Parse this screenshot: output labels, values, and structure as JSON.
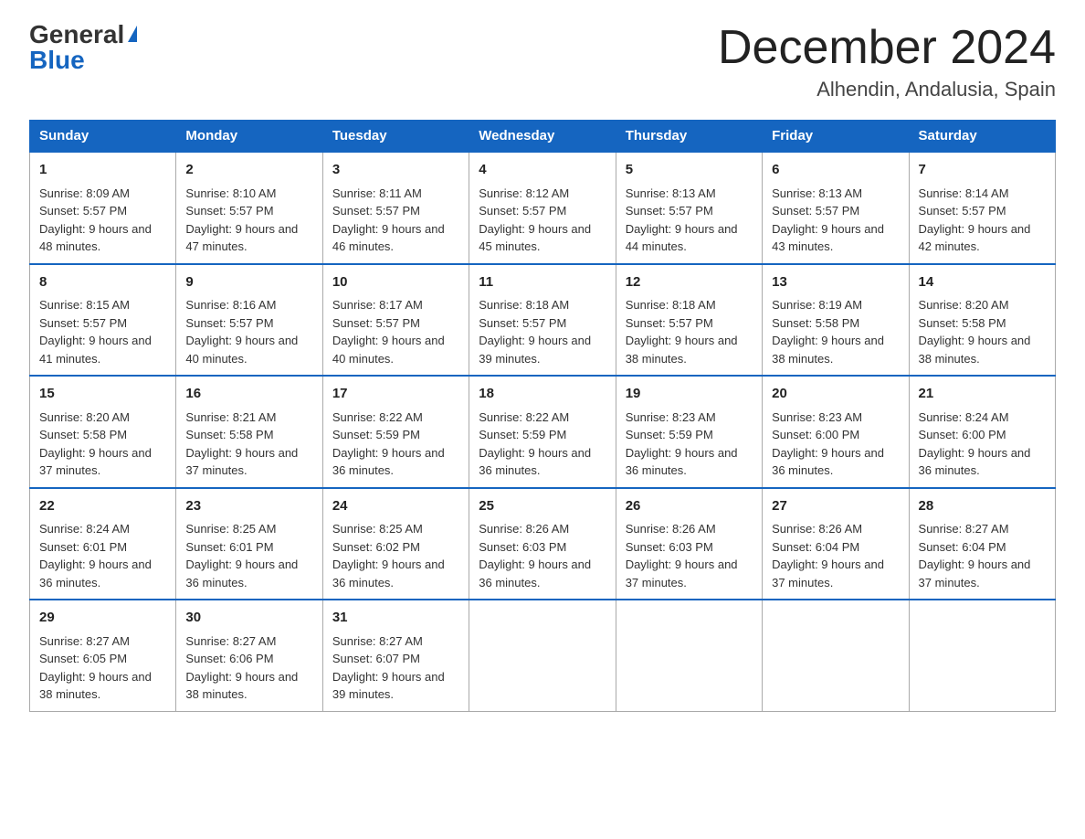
{
  "logo": {
    "general": "General",
    "triangle": "▶",
    "blue": "Blue"
  },
  "title": "December 2024",
  "location": "Alhendin, Andalusia, Spain",
  "days_header": [
    "Sunday",
    "Monday",
    "Tuesday",
    "Wednesday",
    "Thursday",
    "Friday",
    "Saturday"
  ],
  "weeks": [
    [
      {
        "day": "1",
        "sunrise": "8:09 AM",
        "sunset": "5:57 PM",
        "daylight": "9 hours and 48 minutes."
      },
      {
        "day": "2",
        "sunrise": "8:10 AM",
        "sunset": "5:57 PM",
        "daylight": "9 hours and 47 minutes."
      },
      {
        "day": "3",
        "sunrise": "8:11 AM",
        "sunset": "5:57 PM",
        "daylight": "9 hours and 46 minutes."
      },
      {
        "day": "4",
        "sunrise": "8:12 AM",
        "sunset": "5:57 PM",
        "daylight": "9 hours and 45 minutes."
      },
      {
        "day": "5",
        "sunrise": "8:13 AM",
        "sunset": "5:57 PM",
        "daylight": "9 hours and 44 minutes."
      },
      {
        "day": "6",
        "sunrise": "8:13 AM",
        "sunset": "5:57 PM",
        "daylight": "9 hours and 43 minutes."
      },
      {
        "day": "7",
        "sunrise": "8:14 AM",
        "sunset": "5:57 PM",
        "daylight": "9 hours and 42 minutes."
      }
    ],
    [
      {
        "day": "8",
        "sunrise": "8:15 AM",
        "sunset": "5:57 PM",
        "daylight": "9 hours and 41 minutes."
      },
      {
        "day": "9",
        "sunrise": "8:16 AM",
        "sunset": "5:57 PM",
        "daylight": "9 hours and 40 minutes."
      },
      {
        "day": "10",
        "sunrise": "8:17 AM",
        "sunset": "5:57 PM",
        "daylight": "9 hours and 40 minutes."
      },
      {
        "day": "11",
        "sunrise": "8:18 AM",
        "sunset": "5:57 PM",
        "daylight": "9 hours and 39 minutes."
      },
      {
        "day": "12",
        "sunrise": "8:18 AM",
        "sunset": "5:57 PM",
        "daylight": "9 hours and 38 minutes."
      },
      {
        "day": "13",
        "sunrise": "8:19 AM",
        "sunset": "5:58 PM",
        "daylight": "9 hours and 38 minutes."
      },
      {
        "day": "14",
        "sunrise": "8:20 AM",
        "sunset": "5:58 PM",
        "daylight": "9 hours and 38 minutes."
      }
    ],
    [
      {
        "day": "15",
        "sunrise": "8:20 AM",
        "sunset": "5:58 PM",
        "daylight": "9 hours and 37 minutes."
      },
      {
        "day": "16",
        "sunrise": "8:21 AM",
        "sunset": "5:58 PM",
        "daylight": "9 hours and 37 minutes."
      },
      {
        "day": "17",
        "sunrise": "8:22 AM",
        "sunset": "5:59 PM",
        "daylight": "9 hours and 36 minutes."
      },
      {
        "day": "18",
        "sunrise": "8:22 AM",
        "sunset": "5:59 PM",
        "daylight": "9 hours and 36 minutes."
      },
      {
        "day": "19",
        "sunrise": "8:23 AM",
        "sunset": "5:59 PM",
        "daylight": "9 hours and 36 minutes."
      },
      {
        "day": "20",
        "sunrise": "8:23 AM",
        "sunset": "6:00 PM",
        "daylight": "9 hours and 36 minutes."
      },
      {
        "day": "21",
        "sunrise": "8:24 AM",
        "sunset": "6:00 PM",
        "daylight": "9 hours and 36 minutes."
      }
    ],
    [
      {
        "day": "22",
        "sunrise": "8:24 AM",
        "sunset": "6:01 PM",
        "daylight": "9 hours and 36 minutes."
      },
      {
        "day": "23",
        "sunrise": "8:25 AM",
        "sunset": "6:01 PM",
        "daylight": "9 hours and 36 minutes."
      },
      {
        "day": "24",
        "sunrise": "8:25 AM",
        "sunset": "6:02 PM",
        "daylight": "9 hours and 36 minutes."
      },
      {
        "day": "25",
        "sunrise": "8:26 AM",
        "sunset": "6:03 PM",
        "daylight": "9 hours and 36 minutes."
      },
      {
        "day": "26",
        "sunrise": "8:26 AM",
        "sunset": "6:03 PM",
        "daylight": "9 hours and 37 minutes."
      },
      {
        "day": "27",
        "sunrise": "8:26 AM",
        "sunset": "6:04 PM",
        "daylight": "9 hours and 37 minutes."
      },
      {
        "day": "28",
        "sunrise": "8:27 AM",
        "sunset": "6:04 PM",
        "daylight": "9 hours and 37 minutes."
      }
    ],
    [
      {
        "day": "29",
        "sunrise": "8:27 AM",
        "sunset": "6:05 PM",
        "daylight": "9 hours and 38 minutes."
      },
      {
        "day": "30",
        "sunrise": "8:27 AM",
        "sunset": "6:06 PM",
        "daylight": "9 hours and 38 minutes."
      },
      {
        "day": "31",
        "sunrise": "8:27 AM",
        "sunset": "6:07 PM",
        "daylight": "9 hours and 39 minutes."
      },
      null,
      null,
      null,
      null
    ]
  ]
}
